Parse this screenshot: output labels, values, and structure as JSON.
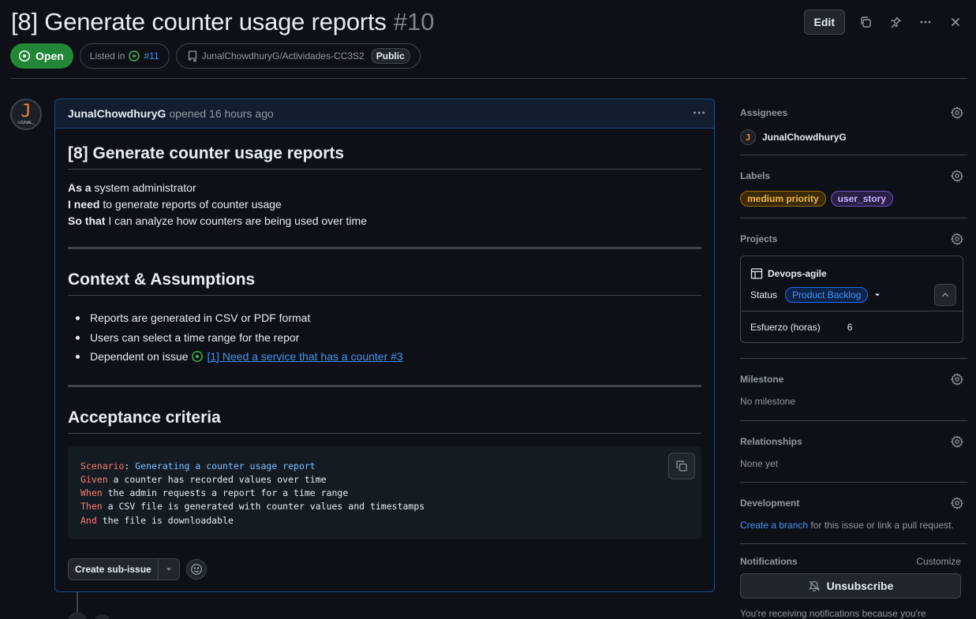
{
  "issue": {
    "title": "[8] Generate counter usage reports",
    "number": "#10",
    "state": "Open",
    "listed_in_label": "Listed in",
    "listed_in_ref": "#11",
    "repo": "JunalChowdhuryG/Actividades-CC3S2",
    "visibility": "Public"
  },
  "header_actions": {
    "edit_label": "Edit"
  },
  "comment": {
    "author": "JunalChowdhuryG",
    "opened_text": "opened 16 hours ago",
    "avatar_letter": "J",
    "avatar_sub": ">JUNAL_",
    "heading": "[8] Generate counter usage reports",
    "story": [
      {
        "bold": "As a",
        "rest": " system administrator"
      },
      {
        "bold": "I need",
        "rest": " to generate reports of counter usage"
      },
      {
        "bold": "So that",
        "rest": " I can analyze how counters are being used over time"
      }
    ],
    "context_heading": "Context & Assumptions",
    "context_items": [
      "Reports are generated in CSV or PDF format",
      "Users can select a time range for the repor",
      "Dependent on issue"
    ],
    "dependency_link": "[1] Need a service that has a counter #3",
    "acceptance_heading": "Acceptance criteria",
    "code": [
      {
        "kw": "Scenario",
        "rest": ": ",
        "extra": "Generating a counter usage report"
      },
      {
        "kw": "Given",
        "rest": " a counter has recorded values over time",
        "extra": ""
      },
      {
        "kw": "When",
        "rest": " the admin requests a report for a time range",
        "extra": ""
      },
      {
        "kw": "Then",
        "rest": " a CSV file is generated with counter values and timestamps",
        "extra": ""
      },
      {
        "kw": "And",
        "rest": " the file is downloadable",
        "extra": ""
      }
    ],
    "create_subissue_label": "Create sub-issue"
  },
  "sidebar": {
    "assignees_title": "Assignees",
    "assignee": "JunalChowdhuryG",
    "labels_title": "Labels",
    "labels": [
      {
        "name": "medium priority",
        "color": "#d29922"
      },
      {
        "name": "user_story",
        "color": "#a371f7"
      }
    ],
    "projects_title": "Projects",
    "project_name": "Devops-agile",
    "status_label": "Status",
    "status_value": "Product Backlog",
    "field_label": "Esfuerzo (horas)",
    "field_value": "6",
    "milestone_title": "Milestone",
    "milestone_value": "No milestone",
    "relationships_title": "Relationships",
    "relationships_value": "None yet",
    "development_title": "Development",
    "development_link": "Create a branch",
    "development_rest": " for this issue or link a pull request.",
    "notifications_title": "Notifications",
    "customize_label": "Customize",
    "unsubscribe_label": "Unsubscribe",
    "notifications_reason": "You're receiving notifications because you're"
  },
  "colors": {
    "open_green": "#238636",
    "link_blue": "#4493f8",
    "comment_border": "#1f4a83"
  }
}
